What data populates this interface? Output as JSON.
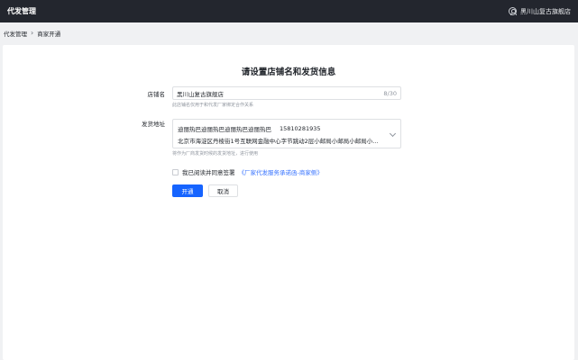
{
  "header": {
    "app_title": "代发管理",
    "user_name": "黑川山复古旗舰店"
  },
  "breadcrumb": {
    "items": [
      "代发管理",
      "商家开通"
    ],
    "separator": "›"
  },
  "form": {
    "title": "请设置店铺名和发货信息",
    "store_name": {
      "label": "店铺名",
      "value": "黑川山复古旗舰店",
      "counter": "8/30",
      "hint": "此店铺名仅用于和代发厂家绑定合作关系"
    },
    "ship_address": {
      "label": "发货地址",
      "contact_name": "迪丽热巴迪丽热巴迪丽热巴迪丽热巴",
      "phone": "15810281935",
      "address": "北京市海淀区丹棱街1号互联网金融中心字节跳动2层小邮局小邮局小邮局小...",
      "hint": "将作为厂商发货时候的发货地址，进行使用"
    },
    "agreement": {
      "text": "我已阅读并同意签署",
      "link": "《厂家代发服务承诺函-商家侧》"
    },
    "buttons": {
      "submit": "开通",
      "cancel": "取消"
    }
  },
  "colors": {
    "topbar": "#23262e",
    "primary": "#1664ff",
    "link": "#3370ff"
  },
  "icons": {
    "user": "user-circle-icon",
    "breadcrumb_separator": "chevron-right-icon",
    "address_dropdown": "chevron-down-icon"
  }
}
